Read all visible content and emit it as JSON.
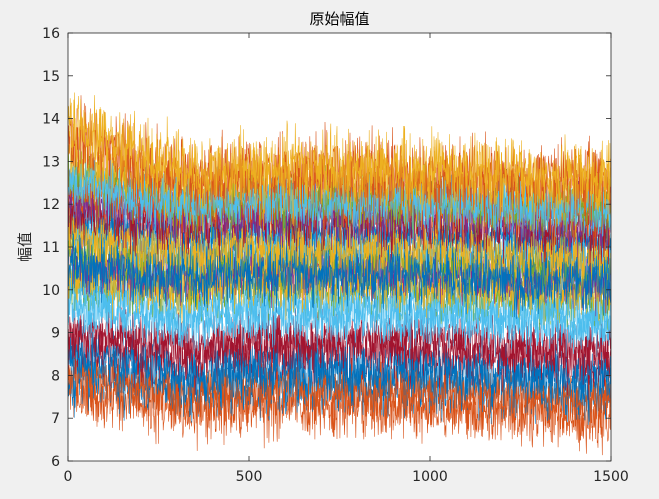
{
  "chart_data": {
    "type": "line",
    "title": "原始幅值",
    "xlabel": "",
    "ylabel": "幅值",
    "xlim": [
      0,
      1500
    ],
    "ylim": [
      6,
      16
    ],
    "xticks": [
      0,
      500,
      1000,
      1500
    ],
    "yticks": [
      6,
      7,
      8,
      9,
      10,
      11,
      12,
      13,
      14,
      15,
      16
    ],
    "xtick_labels": [
      "0",
      "500",
      "1000",
      "1500"
    ],
    "ytick_labels": [
      "6",
      "7",
      "8",
      "9",
      "10",
      "11",
      "12",
      "13",
      "14",
      "15",
      "16"
    ],
    "grid": false,
    "legend": "none",
    "colors": {
      "background": "#f0f0f0",
      "axes_bg": "#ffffff",
      "axis_line": "#262626"
    },
    "x_step": 1,
    "n_points": 1501,
    "series": [
      {
        "color": "#D95319",
        "base_start": 7.6,
        "base_end": 7.1,
        "noise": 0.45,
        "seed": 11
      },
      {
        "color": "#0072BD",
        "base_start": 8.0,
        "base_end": 7.7,
        "noise": 0.45,
        "seed": 12
      },
      {
        "color": "#D95319",
        "base_start": 8.1,
        "base_end": 7.5,
        "noise": 0.4,
        "seed": 13
      },
      {
        "color": "#A2142F",
        "base_start": 8.7,
        "base_end": 8.4,
        "noise": 0.45,
        "seed": 14
      },
      {
        "color": "#0072BD",
        "base_start": 8.5,
        "base_end": 8.0,
        "noise": 0.4,
        "seed": 15
      },
      {
        "color": "#A2142F",
        "base_start": 9.0,
        "base_end": 8.7,
        "noise": 0.4,
        "seed": 16
      },
      {
        "color": "#4DBEEE",
        "base_start": 9.6,
        "base_end": 9.2,
        "noise": 0.4,
        "seed": 17
      },
      {
        "color": "#77AC30",
        "base_start": 10.2,
        "base_end": 9.9,
        "noise": 0.4,
        "seed": 18
      },
      {
        "color": "#4DBEEE",
        "base_start": 10.0,
        "base_end": 9.5,
        "noise": 0.4,
        "seed": 19
      },
      {
        "color": "#EDB120",
        "base_start": 10.4,
        "base_end": 10.1,
        "noise": 0.45,
        "seed": 20
      },
      {
        "color": "#7E2F8E",
        "base_start": 10.7,
        "base_end": 10.4,
        "noise": 0.45,
        "seed": 21
      },
      {
        "color": "#77AC30",
        "base_start": 11.0,
        "base_end": 10.6,
        "noise": 0.4,
        "seed": 22
      },
      {
        "color": "#4DBEEE",
        "base_start": 11.5,
        "base_end": 11.0,
        "noise": 0.4,
        "seed": 23
      },
      {
        "color": "#0072BD",
        "base_start": 11.6,
        "base_end": 11.2,
        "noise": 0.4,
        "seed": 24
      },
      {
        "color": "#EDB120",
        "base_start": 11.3,
        "base_end": 10.8,
        "noise": 0.45,
        "seed": 25
      },
      {
        "color": "#A2142F",
        "base_start": 12.0,
        "base_end": 11.5,
        "noise": 0.45,
        "seed": 26
      },
      {
        "color": "#7E2F8E",
        "base_start": 12.2,
        "base_end": 11.7,
        "noise": 0.45,
        "seed": 27
      },
      {
        "color": "#D95319",
        "base_start": 12.5,
        "base_end": 12.0,
        "noise": 0.5,
        "seed": 28
      },
      {
        "color": "#77AC30",
        "base_start": 12.8,
        "base_end": 12.0,
        "noise": 0.45,
        "seed": 29
      },
      {
        "color": "#EDB120",
        "base_start": 13.1,
        "base_end": 12.3,
        "noise": 0.5,
        "seed": 30
      },
      {
        "color": "#4DBEEE",
        "base_start": 12.5,
        "base_end": 11.9,
        "noise": 0.4,
        "seed": 31
      },
      {
        "color": "#0072BD",
        "base_start": 10.6,
        "base_end": 10.2,
        "noise": 0.4,
        "seed": 32
      },
      {
        "color": "#D95319",
        "base_start": 13.6,
        "base_end": 12.6,
        "noise": 0.55,
        "seed": 33
      },
      {
        "color": "#EDB120",
        "base_start": 13.9,
        "base_end": 12.7,
        "noise": 0.5,
        "seed": 34
      }
    ]
  }
}
